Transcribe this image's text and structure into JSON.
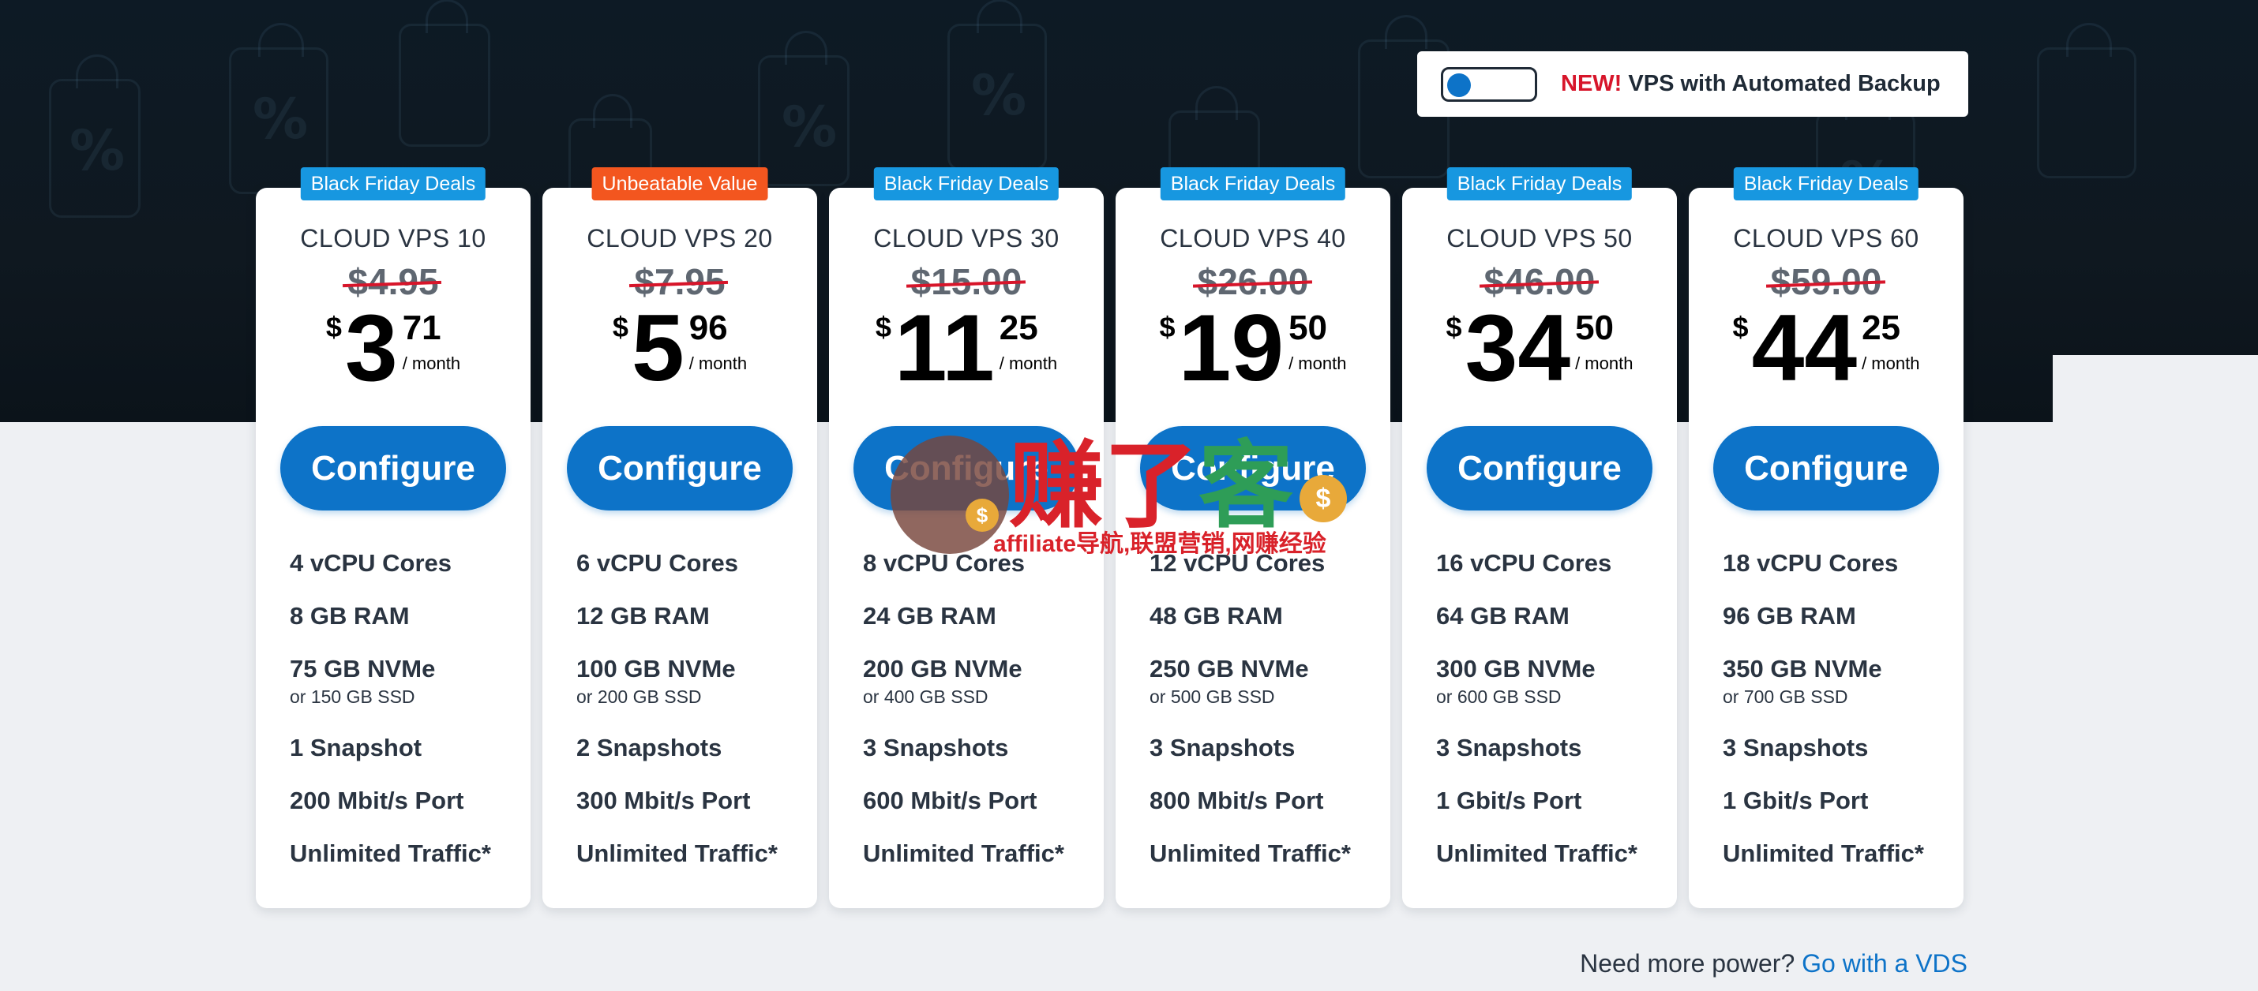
{
  "toggle": {
    "new_label": "NEW!",
    "label": "VPS with Automated Backup",
    "state": "off"
  },
  "plans": [
    {
      "badge": "Black Friday Deals",
      "badge_color": "#1797e0",
      "name": "CLOUD VPS 10",
      "old_price": "$4.95",
      "currency": "$",
      "whole": "3",
      "cents": "71",
      "period": "/ month",
      "button": "Configure",
      "cpu": "4 vCPU Cores",
      "ram": "8 GB RAM",
      "storage": "75 GB NVMe",
      "storage_alt": "or 150 GB SSD",
      "snapshots": "1 Snapshot",
      "port": "200 Mbit/s Port",
      "traffic": "Unlimited Traffic*"
    },
    {
      "badge": "Unbeatable Value",
      "badge_color": "#f3561f",
      "name": "CLOUD VPS 20",
      "old_price": "$7.95",
      "currency": "$",
      "whole": "5",
      "cents": "96",
      "period": "/ month",
      "button": "Configure",
      "cpu": "6 vCPU Cores",
      "ram": "12 GB RAM",
      "storage": "100 GB NVMe",
      "storage_alt": "or 200 GB SSD",
      "snapshots": "2 Snapshots",
      "port": "300 Mbit/s Port",
      "traffic": "Unlimited Traffic*"
    },
    {
      "badge": "Black Friday Deals",
      "badge_color": "#1797e0",
      "name": "CLOUD VPS 30",
      "old_price": "$15.00",
      "currency": "$",
      "whole": "11",
      "cents": "25",
      "period": "/ month",
      "button": "Configure",
      "cpu": "8 vCPU Cores",
      "ram": "24 GB RAM",
      "storage": "200 GB NVMe",
      "storage_alt": "or 400 GB SSD",
      "snapshots": "3 Snapshots",
      "port": "600 Mbit/s Port",
      "traffic": "Unlimited Traffic*"
    },
    {
      "badge": "Black Friday Deals",
      "badge_color": "#1797e0",
      "name": "CLOUD VPS 40",
      "old_price": "$26.00",
      "currency": "$",
      "whole": "19",
      "cents": "50",
      "period": "/ month",
      "button": "Configure",
      "cpu": "12 vCPU Cores",
      "ram": "48 GB RAM",
      "storage": "250 GB NVMe",
      "storage_alt": "or 500 GB SSD",
      "snapshots": "3 Snapshots",
      "port": "800 Mbit/s Port",
      "traffic": "Unlimited Traffic*"
    },
    {
      "badge": "Black Friday Deals",
      "badge_color": "#1797e0",
      "name": "CLOUD VPS 50",
      "old_price": "$46.00",
      "currency": "$",
      "whole": "34",
      "cents": "50",
      "period": "/ month",
      "button": "Configure",
      "cpu": "16 vCPU Cores",
      "ram": "64 GB RAM",
      "storage": "300 GB NVMe",
      "storage_alt": "or 600 GB SSD",
      "snapshots": "3 Snapshots",
      "port": "1 Gbit/s Port",
      "traffic": "Unlimited Traffic*"
    },
    {
      "badge": "Black Friday Deals",
      "badge_color": "#1797e0",
      "name": "CLOUD VPS 60",
      "old_price": "$59.00",
      "currency": "$",
      "whole": "44",
      "cents": "25",
      "period": "/ month",
      "button": "Configure",
      "cpu": "18 vCPU Cores",
      "ram": "96 GB RAM",
      "storage": "350 GB NVMe",
      "storage_alt": "or 700 GB SSD",
      "snapshots": "3 Snapshots",
      "port": "1 Gbit/s Port",
      "traffic": "Unlimited Traffic*"
    }
  ],
  "footer": {
    "question": "Need more power?",
    "link": "Go with a VDS"
  },
  "watermark": {
    "chars": [
      "赚",
      "了",
      "客"
    ],
    "chars_colors": [
      "#d9222a",
      "#d9222a",
      "#2e9d57"
    ],
    "coin_symbol": "$",
    "subtitle": "affiliate导航,联盟营销,网赚经验"
  },
  "colors": {
    "accent": "#0d73c8",
    "badge_blue": "#1797e0",
    "badge_orange": "#f3561f",
    "strike_red": "#d7152a"
  }
}
